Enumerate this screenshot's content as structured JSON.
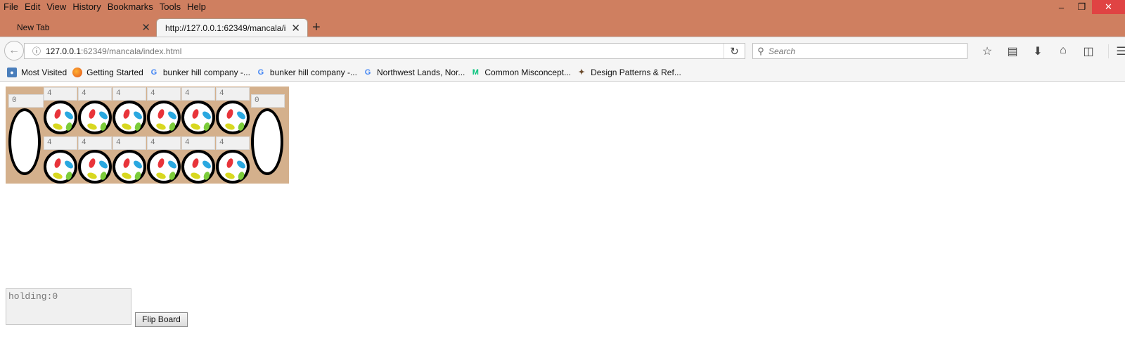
{
  "menu": {
    "file": "File",
    "edit": "Edit",
    "view": "View",
    "history": "History",
    "bookmarks": "Bookmarks",
    "tools": "Tools",
    "help": "Help"
  },
  "tabs": [
    {
      "label": "New Tab"
    },
    {
      "label": "http://127.0.0.1:62349/mancala/i"
    }
  ],
  "navbar": {
    "url_host": "127.0.0.1",
    "url_rest": ":62349/mancala/index.html",
    "search_placeholder": "Search"
  },
  "bookmarks": [
    {
      "label": "Most Visited",
      "icon": "globe-icon"
    },
    {
      "label": "Getting Started",
      "icon": "firefox-icon"
    },
    {
      "label": "bunker hill company -...",
      "icon": "google-icon"
    },
    {
      "label": "bunker hill company -...",
      "icon": "google-icon"
    },
    {
      "label": "Northwest Lands, Nor...",
      "icon": "google-icon"
    },
    {
      "label": "Common Misconcept...",
      "icon": "medium-icon"
    },
    {
      "label": "Design Patterns & Ref...",
      "icon": "design-patterns-icon"
    }
  ],
  "board": {
    "store_left": "0",
    "store_right": "0",
    "top_row": [
      "4",
      "4",
      "4",
      "4",
      "4",
      "4"
    ],
    "bottom_row": [
      "4",
      "4",
      "4",
      "4",
      "4",
      "4"
    ]
  },
  "controls": {
    "holding": "holding:0",
    "flip_label": "Flip Board"
  },
  "colors": {
    "titlebar": "#cf7f60",
    "board": "#d4b08c",
    "close": "#e04343"
  }
}
